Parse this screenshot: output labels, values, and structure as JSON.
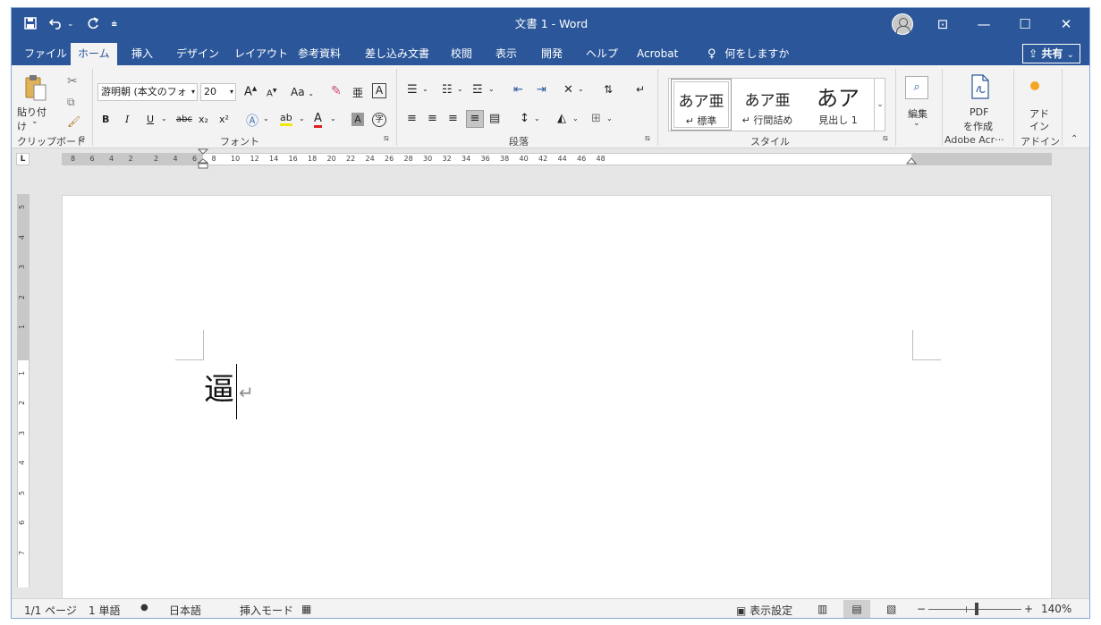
{
  "window": {
    "title": "文書 1  -  Word",
    "qat": {
      "save_icon": "save-icon",
      "undo_icon": "undo-icon",
      "redo_icon": "redo-icon",
      "customize_icon": "customize-qat-icon"
    },
    "controls": {
      "ribbon_display": "⊡",
      "minimize": "—",
      "maximize": "☐",
      "close": "✕"
    }
  },
  "tabs": [
    {
      "label": "ファイル"
    },
    {
      "label": "ホーム",
      "active": true
    },
    {
      "label": "挿入"
    },
    {
      "label": "デザイン"
    },
    {
      "label": "レイアウト"
    },
    {
      "label": "参考資料"
    },
    {
      "label": "差し込み文書"
    },
    {
      "label": "校閲"
    },
    {
      "label": "表示"
    },
    {
      "label": "開発"
    },
    {
      "label": "ヘルプ"
    },
    {
      "label": "Acrobat"
    },
    {
      "label": "何をしますか"
    }
  ],
  "share_label": "共有",
  "ribbon": {
    "clipboard": {
      "paste": "貼り付け",
      "group": "クリップボード"
    },
    "font": {
      "family": "游明朝 (本文のフォ",
      "size": "20",
      "grow": "A",
      "shrink": "A",
      "case": "Aa",
      "bold": "B",
      "italic": "I",
      "underline": "U",
      "strike": "abc",
      "subscript": "x₂",
      "superscript": "x²",
      "highlight": "ab",
      "font_color": "A",
      "shading": "A",
      "enclosed": "字",
      "group": "フォント"
    },
    "paragraph": {
      "group": "段落"
    },
    "styles": {
      "items": [
        {
          "sample": "あア亜",
          "name": "↵ 標準"
        },
        {
          "sample": "あア亜",
          "name": "↵ 行間詰め"
        },
        {
          "sample": "あア",
          "name": "見出し 1"
        }
      ],
      "group": "スタイル"
    },
    "editing": {
      "label": "編集"
    },
    "pdf": {
      "line1": "PDF",
      "line2": "を作成",
      "group": "Adobe Acr···"
    },
    "addins": {
      "line1": "アド",
      "line2": "イン",
      "group": "アドイン"
    }
  },
  "ruler": {
    "tab_selector": "L",
    "labels": [
      "8",
      "6",
      "4",
      "2",
      "2",
      "4",
      "6",
      "8",
      "10",
      "12",
      "14",
      "16",
      "18",
      "20",
      "22",
      "24",
      "26",
      "28",
      "30",
      "32",
      "34",
      "36",
      "38",
      "40",
      "42",
      "44",
      "46",
      "48"
    ],
    "vlabels": [
      "5",
      "4",
      "3",
      "2",
      "1",
      "1",
      "2",
      "3",
      "4",
      "5",
      "6",
      "7"
    ]
  },
  "document": {
    "text": "逼",
    "para_mark": "↵"
  },
  "status": {
    "page": "1/1 ページ",
    "words": "1 単語",
    "language": "日本語",
    "mode": "挿入モード",
    "display_settings": "表示設定",
    "zoom": "140%",
    "zoom_minus": "−",
    "zoom_plus": "+"
  }
}
